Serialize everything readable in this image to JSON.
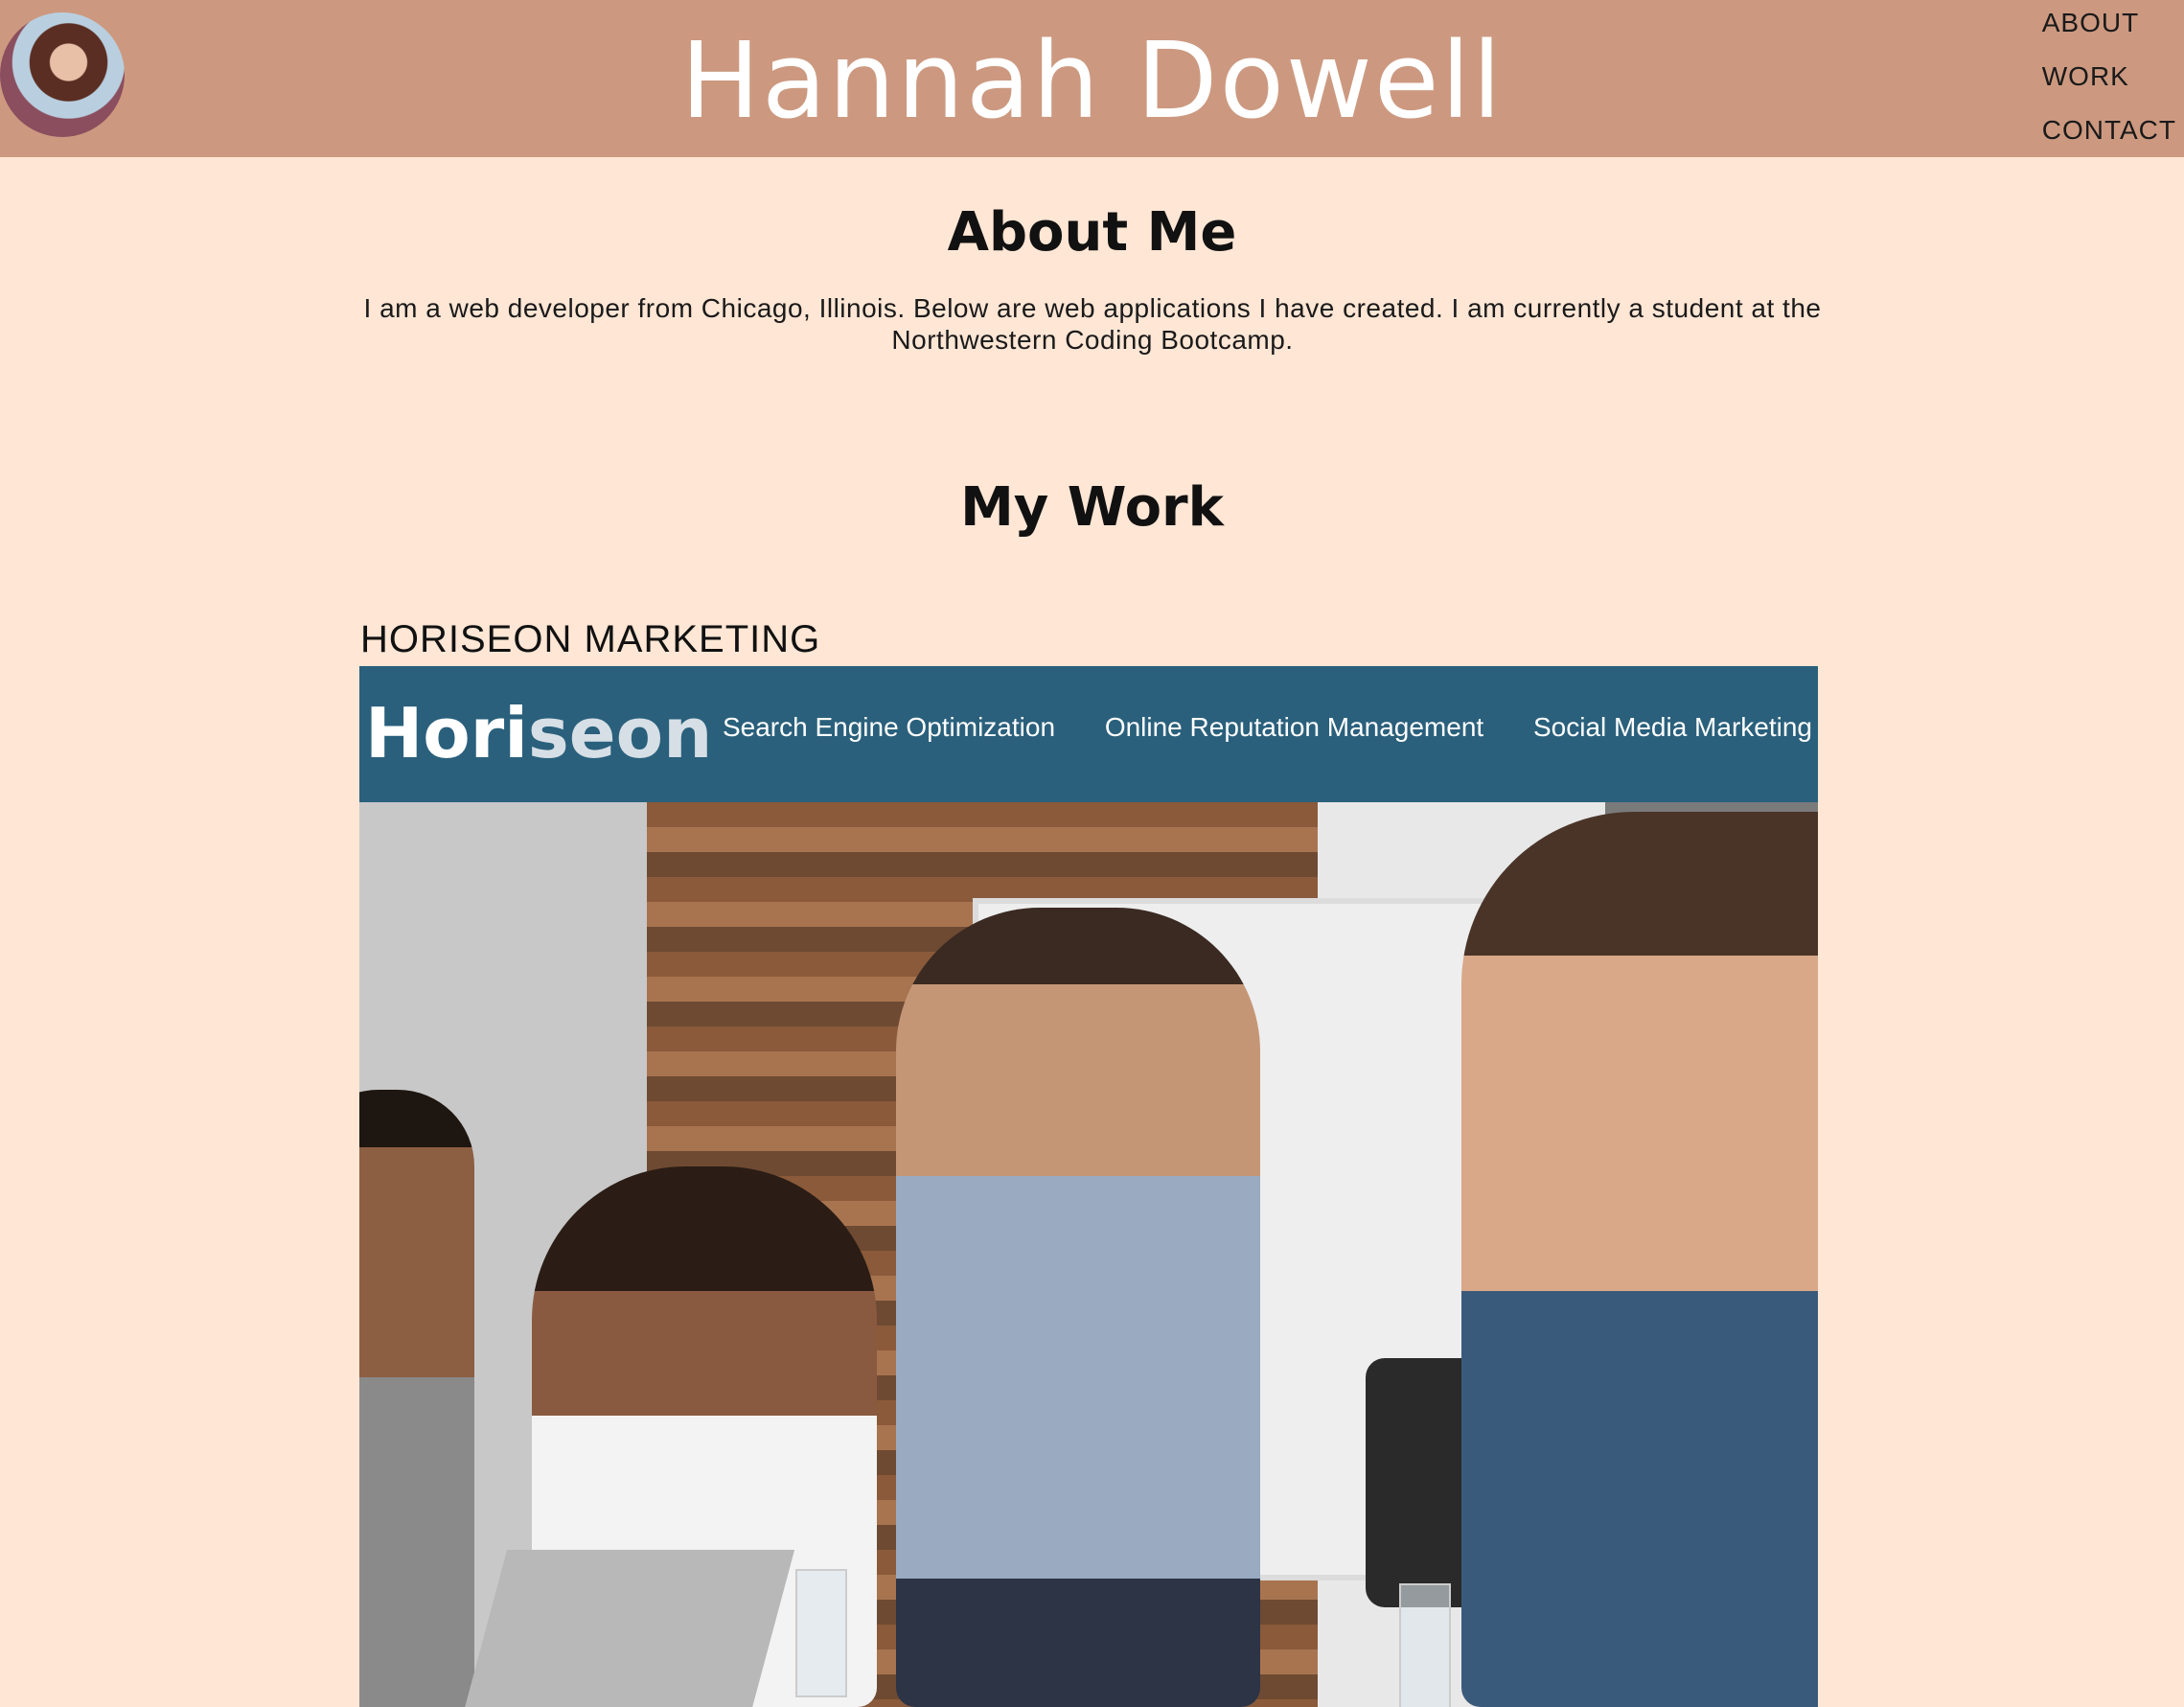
{
  "header": {
    "site_title": "Hannah Dowell",
    "nav": [
      "ABOUT",
      "WORK",
      "CONTACT"
    ]
  },
  "about": {
    "heading": "About Me",
    "text": "I am a web developer from Chicago, Illinois. Below are web applications I have created. I am currently a student at the Northwestern Coding Bootcamp."
  },
  "work": {
    "heading": "My Work",
    "projects": [
      {
        "label": "HORISEON MARKETING",
        "screenshot": {
          "logo_bold": "Hori",
          "logo_light": "seon",
          "nav": [
            "Search Engine Optimization",
            "Online Reputation Management",
            "Social Media Marketing"
          ]
        }
      }
    ]
  },
  "colors": {
    "header_bg": "#cc9980",
    "page_bg": "#ffe6d5",
    "project_header_bg": "#2a607c"
  }
}
